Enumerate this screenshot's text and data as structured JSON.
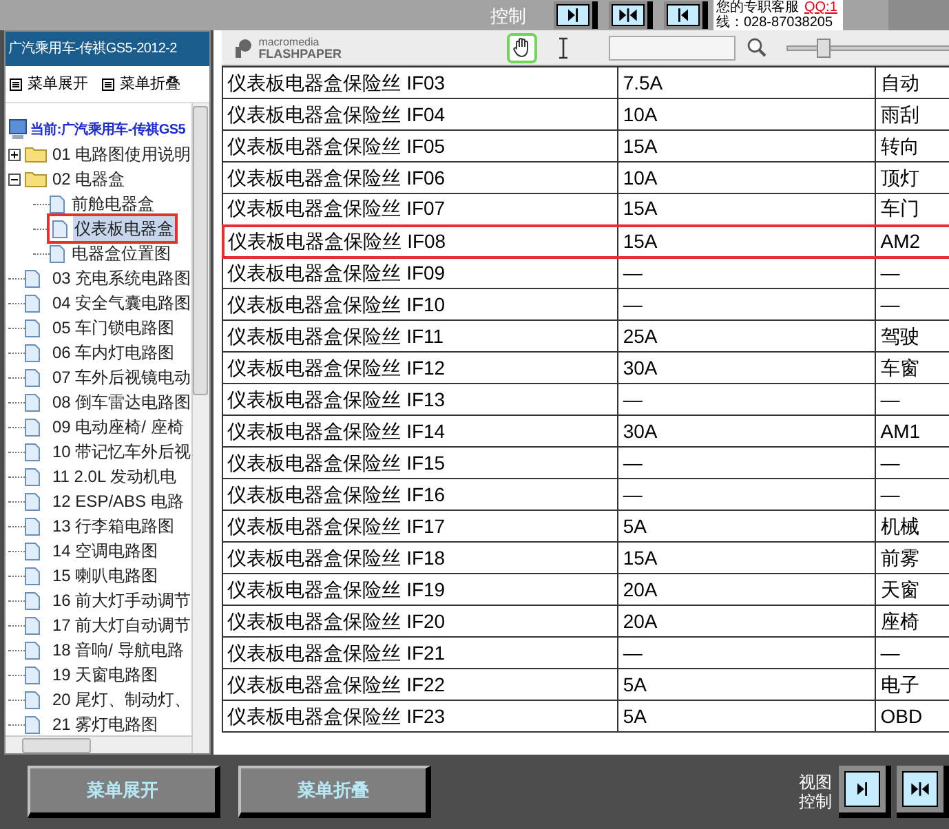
{
  "top_strip": {
    "label": "控制",
    "nav_buttons": [
      {
        "kind": "right"
      },
      {
        "kind": "both"
      },
      {
        "kind": "left"
      }
    ],
    "contact": {
      "line_1": "您的专职客服",
      "qq": "QQ:1",
      "line_2": "线：028-87038205"
    }
  },
  "left_panel": {
    "title": "广汽乘用车-传祺GS5-2012-2",
    "menu_buttons": [
      "菜单展开",
      "菜单折叠"
    ],
    "tree": {
      "root": "当前:广汽乘用车-传祺GS5",
      "items": [
        {
          "label": "01 电路图使用说明",
          "kind": "folder",
          "expanded": false
        },
        {
          "label": "02 电器盒",
          "kind": "folder",
          "expanded": true,
          "children": [
            {
              "label": "前舱电器盒",
              "selected": false
            },
            {
              "label": "仪表板电器盒",
              "selected": true
            },
            {
              "label": "电器盒位置图",
              "selected": false
            }
          ]
        },
        {
          "label": "03 充电系统电路图",
          "kind": "page"
        },
        {
          "label": "04 安全气囊电路图",
          "kind": "page"
        },
        {
          "label": "05 车门锁电路图",
          "kind": "page"
        },
        {
          "label": "06 车内灯电路图",
          "kind": "page"
        },
        {
          "label": "07 车外后视镜电动",
          "kind": "page"
        },
        {
          "label": "08 倒车雷达电路图",
          "kind": "page"
        },
        {
          "label": "09 电动座椅/ 座椅",
          "kind": "page"
        },
        {
          "label": "10 带记忆车外后视",
          "kind": "page"
        },
        {
          "label": "11 2.0L 发动机电",
          "kind": "page"
        },
        {
          "label": "12 ESP/ABS 电路",
          "kind": "page"
        },
        {
          "label": "13 行李箱电路图",
          "kind": "page"
        },
        {
          "label": "14 空调电路图",
          "kind": "page"
        },
        {
          "label": "15 喇叭电路图",
          "kind": "page"
        },
        {
          "label": "16 前大灯手动调节",
          "kind": "page"
        },
        {
          "label": "17 前大灯自动调节",
          "kind": "page"
        },
        {
          "label": "18 音响/ 导航电路",
          "kind": "page"
        },
        {
          "label": "19 天窗电路图",
          "kind": "page"
        },
        {
          "label": "20 尾灯、制动灯、",
          "kind": "page"
        },
        {
          "label": "21 雾灯电路图",
          "kind": "page"
        }
      ]
    }
  },
  "viewer": {
    "logo": {
      "brand": "macromedia",
      "product": "FLASHPAPER"
    },
    "tools": [
      {
        "kind": "hand",
        "selected": true
      },
      {
        "kind": "text",
        "selected": false
      }
    ],
    "zoom": {
      "level": 0.2
    },
    "table": {
      "rows": [
        {
          "cells": [
            "仪表板电器盒保险丝 IF03",
            "7.5A",
            "自动"
          ],
          "highlighted": false
        },
        {
          "cells": [
            "仪表板电器盒保险丝 IF04",
            "10A",
            "雨刮"
          ],
          "highlighted": false
        },
        {
          "cells": [
            "仪表板电器盒保险丝 IF05",
            "15A",
            "转向"
          ],
          "highlighted": false
        },
        {
          "cells": [
            "仪表板电器盒保险丝 IF06",
            "10A",
            "顶灯"
          ],
          "highlighted": false
        },
        {
          "cells": [
            "仪表板电器盒保险丝 IF07",
            "15A",
            "车门"
          ],
          "highlighted": false
        },
        {
          "cells": [
            "仪表板电器盒保险丝 IF08",
            "15A",
            "AM2"
          ],
          "highlighted": true
        },
        {
          "cells": [
            "仪表板电器盒保险丝 IF09",
            "—",
            "—"
          ],
          "highlighted": false
        },
        {
          "cells": [
            "仪表板电器盒保险丝 IF10",
            "—",
            "—"
          ],
          "highlighted": false
        },
        {
          "cells": [
            "仪表板电器盒保险丝 IF11",
            "25A",
            "驾驶"
          ],
          "highlighted": false
        },
        {
          "cells": [
            "仪表板电器盒保险丝 IF12",
            "30A",
            "车窗"
          ],
          "highlighted": false
        },
        {
          "cells": [
            "仪表板电器盒保险丝 IF13",
            "—",
            "—"
          ],
          "highlighted": false
        },
        {
          "cells": [
            "仪表板电器盒保险丝 IF14",
            "30A",
            "AM1"
          ],
          "highlighted": false
        },
        {
          "cells": [
            "仪表板电器盒保险丝 IF15",
            "—",
            "—"
          ],
          "highlighted": false
        },
        {
          "cells": [
            "仪表板电器盒保险丝 IF16",
            "—",
            "—"
          ],
          "highlighted": false
        },
        {
          "cells": [
            "仪表板电器盒保险丝 IF17",
            "5A",
            "机械"
          ],
          "highlighted": false
        },
        {
          "cells": [
            "仪表板电器盒保险丝 IF18",
            "15A",
            "前雾"
          ],
          "highlighted": false
        },
        {
          "cells": [
            "仪表板电器盒保险丝 IF19",
            "20A",
            "天窗"
          ],
          "highlighted": false
        },
        {
          "cells": [
            "仪表板电器盒保险丝 IF20",
            "20A",
            "座椅"
          ],
          "highlighted": false
        },
        {
          "cells": [
            "仪表板电器盒保险丝 IF21",
            "—",
            "—"
          ],
          "highlighted": false
        },
        {
          "cells": [
            "仪表板电器盒保险丝 IF22",
            "5A",
            "电子"
          ],
          "highlighted": false
        },
        {
          "cells": [
            "仪表板电器盒保险丝 IF23",
            "5A",
            "OBD"
          ],
          "highlighted": false
        }
      ]
    }
  },
  "bottom_bar": {
    "buttons": [
      "菜单展开",
      "菜单折叠"
    ],
    "view_control": {
      "label": "视图控制",
      "buttons": [
        {
          "kind": "right"
        },
        {
          "kind": "both"
        }
      ]
    }
  }
}
